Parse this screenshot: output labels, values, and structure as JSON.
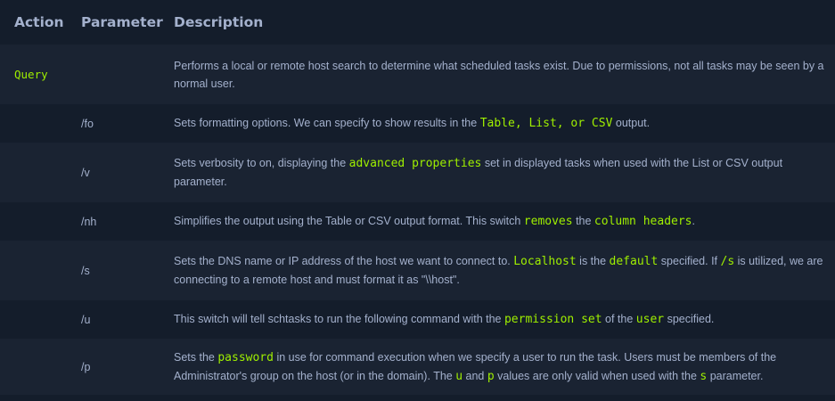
{
  "headers": {
    "action": "Action",
    "parameter": "Parameter",
    "description": "Description"
  },
  "rows": [
    {
      "action": "Query",
      "param": "",
      "segs": [
        {
          "t": "Performs a local or remote host search to determine what scheduled tasks exist. Due to permissions, not all tasks may be seen by a normal user."
        }
      ]
    },
    {
      "action": "",
      "param": "/fo",
      "segs": [
        {
          "t": "Sets formatting options. We can specify to show results in the "
        },
        {
          "t": "Table, List, or CSV",
          "code": true
        },
        {
          "t": " output."
        }
      ]
    },
    {
      "action": "",
      "param": "/v",
      "segs": [
        {
          "t": "Sets verbosity to on, displaying the "
        },
        {
          "t": "advanced properties",
          "code": true
        },
        {
          "t": " set in displayed tasks when used with the List or CSV output parameter."
        }
      ]
    },
    {
      "action": "",
      "param": "/nh",
      "segs": [
        {
          "t": "Simplifies the output using the Table or CSV output format. This switch "
        },
        {
          "t": "removes",
          "code": true
        },
        {
          "t": " the "
        },
        {
          "t": "column headers",
          "code": true
        },
        {
          "t": "."
        }
      ]
    },
    {
      "action": "",
      "param": "/s",
      "segs": [
        {
          "t": "Sets the DNS name or IP address of the host we want to connect to. "
        },
        {
          "t": "Localhost",
          "code": true
        },
        {
          "t": " is the "
        },
        {
          "t": "default",
          "code": true
        },
        {
          "t": " specified. If "
        },
        {
          "t": "/s",
          "code": true
        },
        {
          "t": " is utilized, we are connecting to a remote host and must format it as \"\\\\host\"."
        }
      ]
    },
    {
      "action": "",
      "param": "/u",
      "segs": [
        {
          "t": "This switch will tell schtasks to run the following command with the "
        },
        {
          "t": "permission set",
          "code": true
        },
        {
          "t": " of the "
        },
        {
          "t": "user",
          "code": true
        },
        {
          "t": " specified."
        }
      ]
    },
    {
      "action": "",
      "param": "/p",
      "segs": [
        {
          "t": "Sets the "
        },
        {
          "t": "password",
          "code": true
        },
        {
          "t": " in use for command execution when we specify a user to run the task. Users must be members of the Administrator's group on the host (or in the domain). The "
        },
        {
          "t": "u",
          "code": true
        },
        {
          "t": " and "
        },
        {
          "t": "p",
          "code": true
        },
        {
          "t": " values are only valid when used with the "
        },
        {
          "t": "s",
          "code": true
        },
        {
          "t": " parameter."
        }
      ]
    }
  ]
}
